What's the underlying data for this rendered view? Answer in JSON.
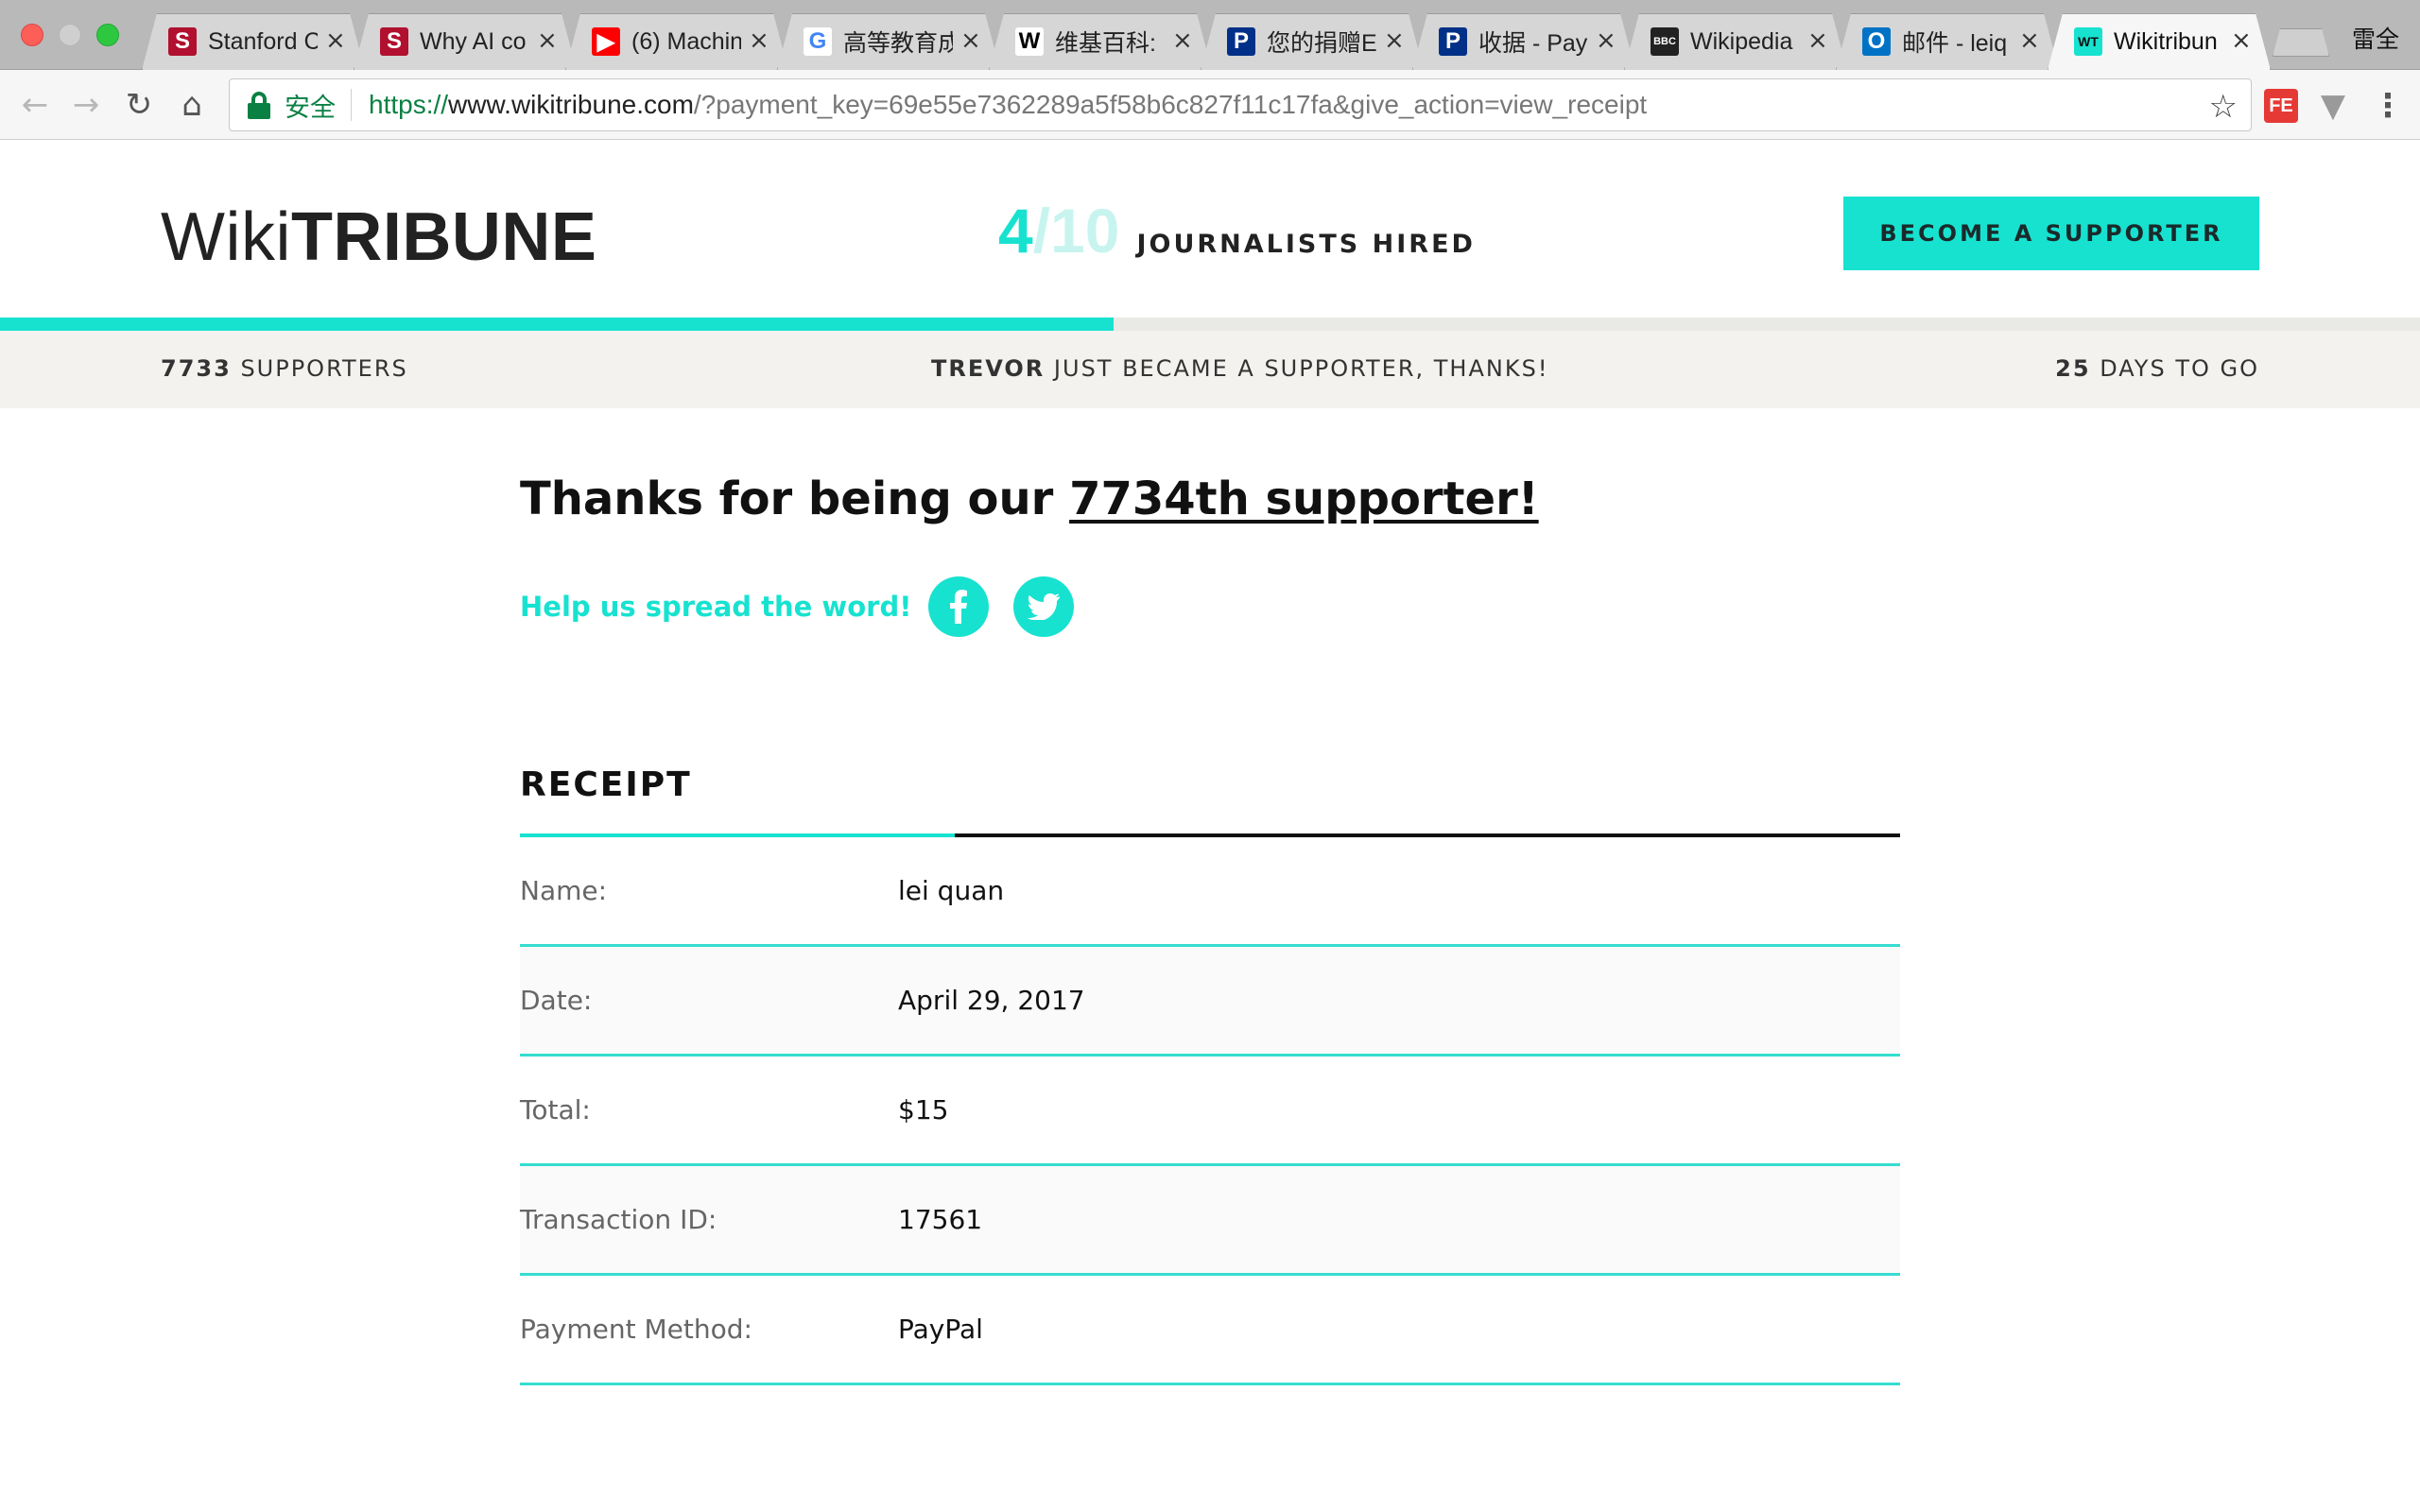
{
  "browser": {
    "tabs": [
      {
        "title": "Stanford C",
        "favicon": "S",
        "favicon_color": "#b1102e"
      },
      {
        "title": "Why AI co",
        "favicon": "S",
        "favicon_color": "#b1102e"
      },
      {
        "title": "(6) Machin",
        "favicon": "▶",
        "favicon_color": "#ff0000"
      },
      {
        "title": "高等教育成",
        "favicon": "G",
        "favicon_color": "#4285f4"
      },
      {
        "title": "维基百科:",
        "favicon": "W",
        "favicon_color": "#000000"
      },
      {
        "title": "您的捐赠E",
        "favicon": "P",
        "favicon_color": "#003087"
      },
      {
        "title": "收据 - Pay",
        "favicon": "P",
        "favicon_color": "#003087"
      },
      {
        "title": "Wikipedia",
        "favicon": "BBC",
        "favicon_color": "#222222"
      },
      {
        "title": "邮件 - leiq",
        "favicon": "O",
        "favicon_color": "#0072c6"
      },
      {
        "title": "Wikitribun",
        "favicon": "WT",
        "favicon_color": "#17e2d0",
        "active": true
      }
    ],
    "close_glyph": "×",
    "profile_name": "雷全",
    "secure_label": "安全",
    "url": {
      "scheme": "https://",
      "host": "www.wikitribune.com",
      "path": "/?payment_key=69e55e7362289a5f58b6c827f11c17fa&give_action=view_receipt"
    }
  },
  "header": {
    "logo_light": "Wiki",
    "logo_bold": "TRIBUNE",
    "hired_count": "4",
    "hired_total": "/10",
    "hired_label": "JOURNALISTS HIRED",
    "cta_label": "BECOME A SUPPORTER",
    "progress_fraction": 0.46,
    "accent_color": "#17e2d0"
  },
  "stats": {
    "supporters_count": "7733",
    "supporters_label": "SUPPORTERS",
    "recent_name": "TREVOR",
    "recent_text": "JUST BECAME A SUPPORTER, THANKS!",
    "days_count": "25",
    "days_label": "DAYS TO GO"
  },
  "main": {
    "thanks_prefix": "Thanks for being our ",
    "thanks_link": "7734th supporter!",
    "spread_text": "Help us spread the word!",
    "receipt_title": "RECEIPT",
    "receipt_rows": [
      {
        "label": "Name:",
        "value": "lei quan"
      },
      {
        "label": "Date:",
        "value": "April 29, 2017"
      },
      {
        "label": "Total:",
        "value": "$15"
      },
      {
        "label": "Transaction ID:",
        "value": "17561"
      },
      {
        "label": "Payment Method:",
        "value": "PayPal"
      }
    ]
  }
}
